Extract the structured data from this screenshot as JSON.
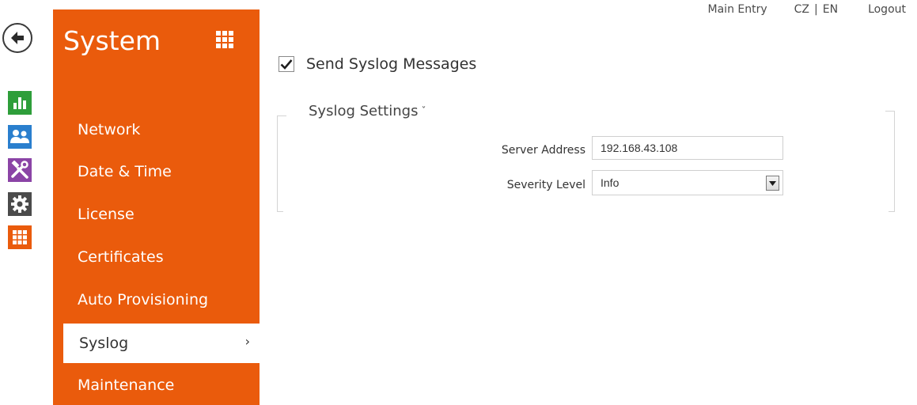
{
  "top_links": {
    "main_entry": "Main Entry",
    "lang_cz": "CZ",
    "lang_sep": "|",
    "lang_en": "EN",
    "logout": "Logout"
  },
  "rail": {
    "icons": [
      "back-arrow-icon",
      "bar-chart-icon",
      "users-icon",
      "tools-icon",
      "gear-icon",
      "grid-icon"
    ],
    "colors": {
      "status": "#2e9e3a",
      "directory": "#2a7fce",
      "hardware": "#8b44a6",
      "services": "#4b4b4b",
      "system": "#ea5b0c"
    }
  },
  "sidebar": {
    "title": "System",
    "accent_color": "#ea5b0c",
    "items": [
      {
        "label": "Network"
      },
      {
        "label": "Date & Time"
      },
      {
        "label": "License"
      },
      {
        "label": "Certificates"
      },
      {
        "label": "Auto Provisioning"
      },
      {
        "label": "Syslog",
        "active": true
      },
      {
        "label": "Maintenance"
      }
    ]
  },
  "main": {
    "send_syslog": {
      "label": "Send Syslog Messages",
      "checked": true
    },
    "section": {
      "title": "Syslog Settings",
      "server_address": {
        "label": "Server Address",
        "value": "192.168.43.108"
      },
      "severity_level": {
        "label": "Severity Level",
        "value": "Info"
      }
    }
  }
}
